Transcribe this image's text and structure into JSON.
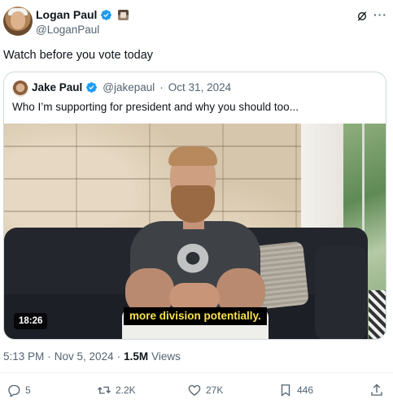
{
  "author": {
    "name": "Logan Paul",
    "handle": "@LoganPaul"
  },
  "tweet": {
    "text": "Watch before you vote today"
  },
  "quote": {
    "name": "Jake Paul",
    "handle": "@jakepaul",
    "separator": "·",
    "date": "Oct 31, 2024",
    "text": "Who I’m supporting for president and why you should too...",
    "video": {
      "duration": "18:26",
      "subtitle": "more division potentially."
    }
  },
  "meta": {
    "time": "5:13 PM",
    "sep1": "·",
    "date": "Nov 5, 2024",
    "sep2": "·",
    "views_count": "1.5M",
    "views_label": "Views"
  },
  "actions": {
    "replies": "5",
    "reposts": "2.2K",
    "likes": "27K",
    "bookmarks": "446"
  },
  "colors": {
    "verified": "#1d9bf0",
    "muted": "#536471",
    "subtitle": "#f7e14b"
  },
  "icons": [
    "verified-icon",
    "grok-icon",
    "more-icon",
    "reply-icon",
    "repost-icon",
    "like-icon",
    "bookmark-icon",
    "share-icon"
  ]
}
